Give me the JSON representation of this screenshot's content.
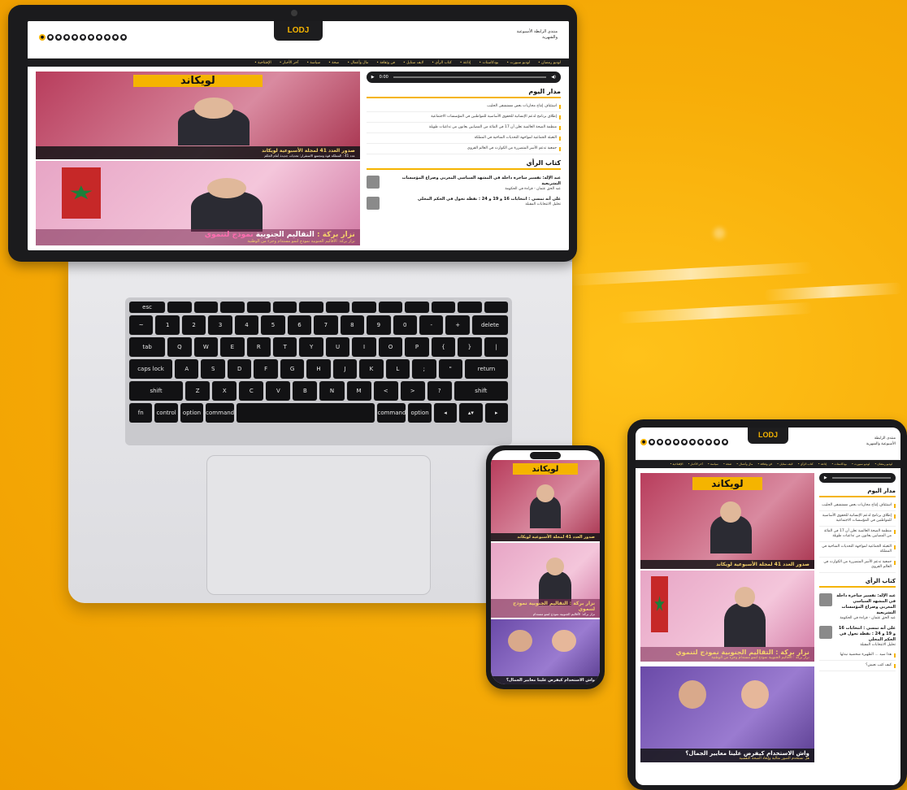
{
  "site": {
    "logo": "LODJ",
    "tagline": "منتدى الرابطة الأسبوعية والشهرية",
    "social_icons": [
      "youtube-icon",
      "tiktok-icon",
      "instagram-icon",
      "pinterest-icon",
      "telegram-icon",
      "facebook-icon",
      "linkedin-icon",
      "x-icon",
      "whatsapp-icon",
      "rss-icon",
      "share-icon"
    ],
    "nav_items": [
      "الإفتتاحية",
      "آخر الأخبار",
      "سياسة",
      "صحة",
      "مال وأعمال",
      "فن وثقافة",
      "لايف ستايل",
      "كتاب الرأي",
      "إذاعة",
      "بودكاستات",
      "لوديو سبورت",
      "لوديو رمضان"
    ]
  },
  "laptop": {
    "hero1": {
      "banner": "لويكاند",
      "headline": "صدور العدد 41 لمجلة الأسبوعية لويكاند",
      "subline": "عدد 41 : المملكة قوة ومجتمع الاستقرار: تحديات جديدة أمام الحكم"
    },
    "hero2": {
      "headline_pre": "نزار بركة : ",
      "headline_main": "التقاليم الجنوبية",
      "headline_post": "نموذج لتنموي",
      "subline": "نزار بركة: الأقاليم الجنوبية نموذج لنمو مستدام وجزء من الوطنية"
    },
    "audio_time": "0:00",
    "today_title": "مدار اليوم",
    "today_items": [
      "استئناف إنتاج محاربات بعض مستشفى الحليب",
      "إطلاق برنامج لدعم الإنسانية للحقوق الأساسية للمواطنين في المؤسسات الاجتماعية",
      "منظمة الصحة العالمية تعلن أن 17 في المائة من المصابين يعانون من تداعيات طويلة",
      "التعبئة الجماعية لمواجهة التحديات المناخية في المملكة",
      "جمعية تدعم الأسر المتضررة من الكوارث في العالم القروي"
    ],
    "opinion_title": "كتاب الرأي",
    "opinion_items": [
      {
        "title": "عبد الإله: تفسير ساخرة داخلة في المشهد السياسي المغربي وصراع المؤسسات التشريعية",
        "body": "عبد الحق عثمان - قراءة في الحكومة"
      },
      {
        "title": "على أنه تمسي : انتخابات 16 و 19 و 24 : نقطة تحول في الحكم المحلي",
        "body": "تحليل الانتخابات المقبلة"
      }
    ]
  },
  "phone": {
    "hero1_headline": "صدور العدد 41 لمجلة الأسبوعية لويكاند",
    "hero2_headline": "نزار بركة : التقاليم الجنوبية نموذج لتنموي",
    "hero2_sub": "نزار بركة: الأقاليم الجنوبية نموذج لنمو مستدام",
    "hero3_headline": "واش الاستخدام كيفرض علينا معايير الجمال؟"
  },
  "tablet": {
    "today_title": "مدار اليوم",
    "opinion_title": "كتاب الرأي",
    "hero1_headline": "صدور العدد 41 لمجلة الأسبوعية لويكاند",
    "hero2_headline": "نزار بركة : التقاليم الجنوبية نموذج لتنموي",
    "hero2_sub": "نزار بركة : الأقاليم الجنوبية نموذج لنمو مستدام وجزء من الوطنية",
    "hero3_headline": "واش الاستخدام كيفرض علينا معايير الجمال؟",
    "hero3_sub": "هل تستخدم الصور مثالية وإبعاد الصحة النفسية",
    "extra_items": [
      "هذا سيد ... الظهيرة شخصية نبدئها",
      "كيف كتب نعيش؟"
    ]
  },
  "keyboard_rows": [
    [
      "esc",
      "",
      "",
      "",
      "",
      "",
      "",
      "",
      "",
      "",
      "",
      "",
      "",
      ""
    ],
    [
      "~",
      "1",
      "2",
      "3",
      "4",
      "5",
      "6",
      "7",
      "8",
      "9",
      "0",
      "-",
      "+",
      "delete"
    ],
    [
      "tab",
      "Q",
      "W",
      "E",
      "R",
      "T",
      "Y",
      "U",
      "I",
      "O",
      "P",
      "{",
      "}",
      "|"
    ],
    [
      "caps lock",
      "A",
      "S",
      "D",
      "F",
      "G",
      "H",
      "J",
      "K",
      "L",
      ";",
      "\"",
      "return"
    ],
    [
      "shift",
      "Z",
      "X",
      "C",
      "V",
      "B",
      "N",
      "M",
      "<",
      ">",
      "?",
      "shift"
    ],
    [
      "fn",
      "control",
      "option",
      "command",
      "",
      "command",
      "option",
      "◂",
      "▴▾",
      "▸"
    ]
  ]
}
